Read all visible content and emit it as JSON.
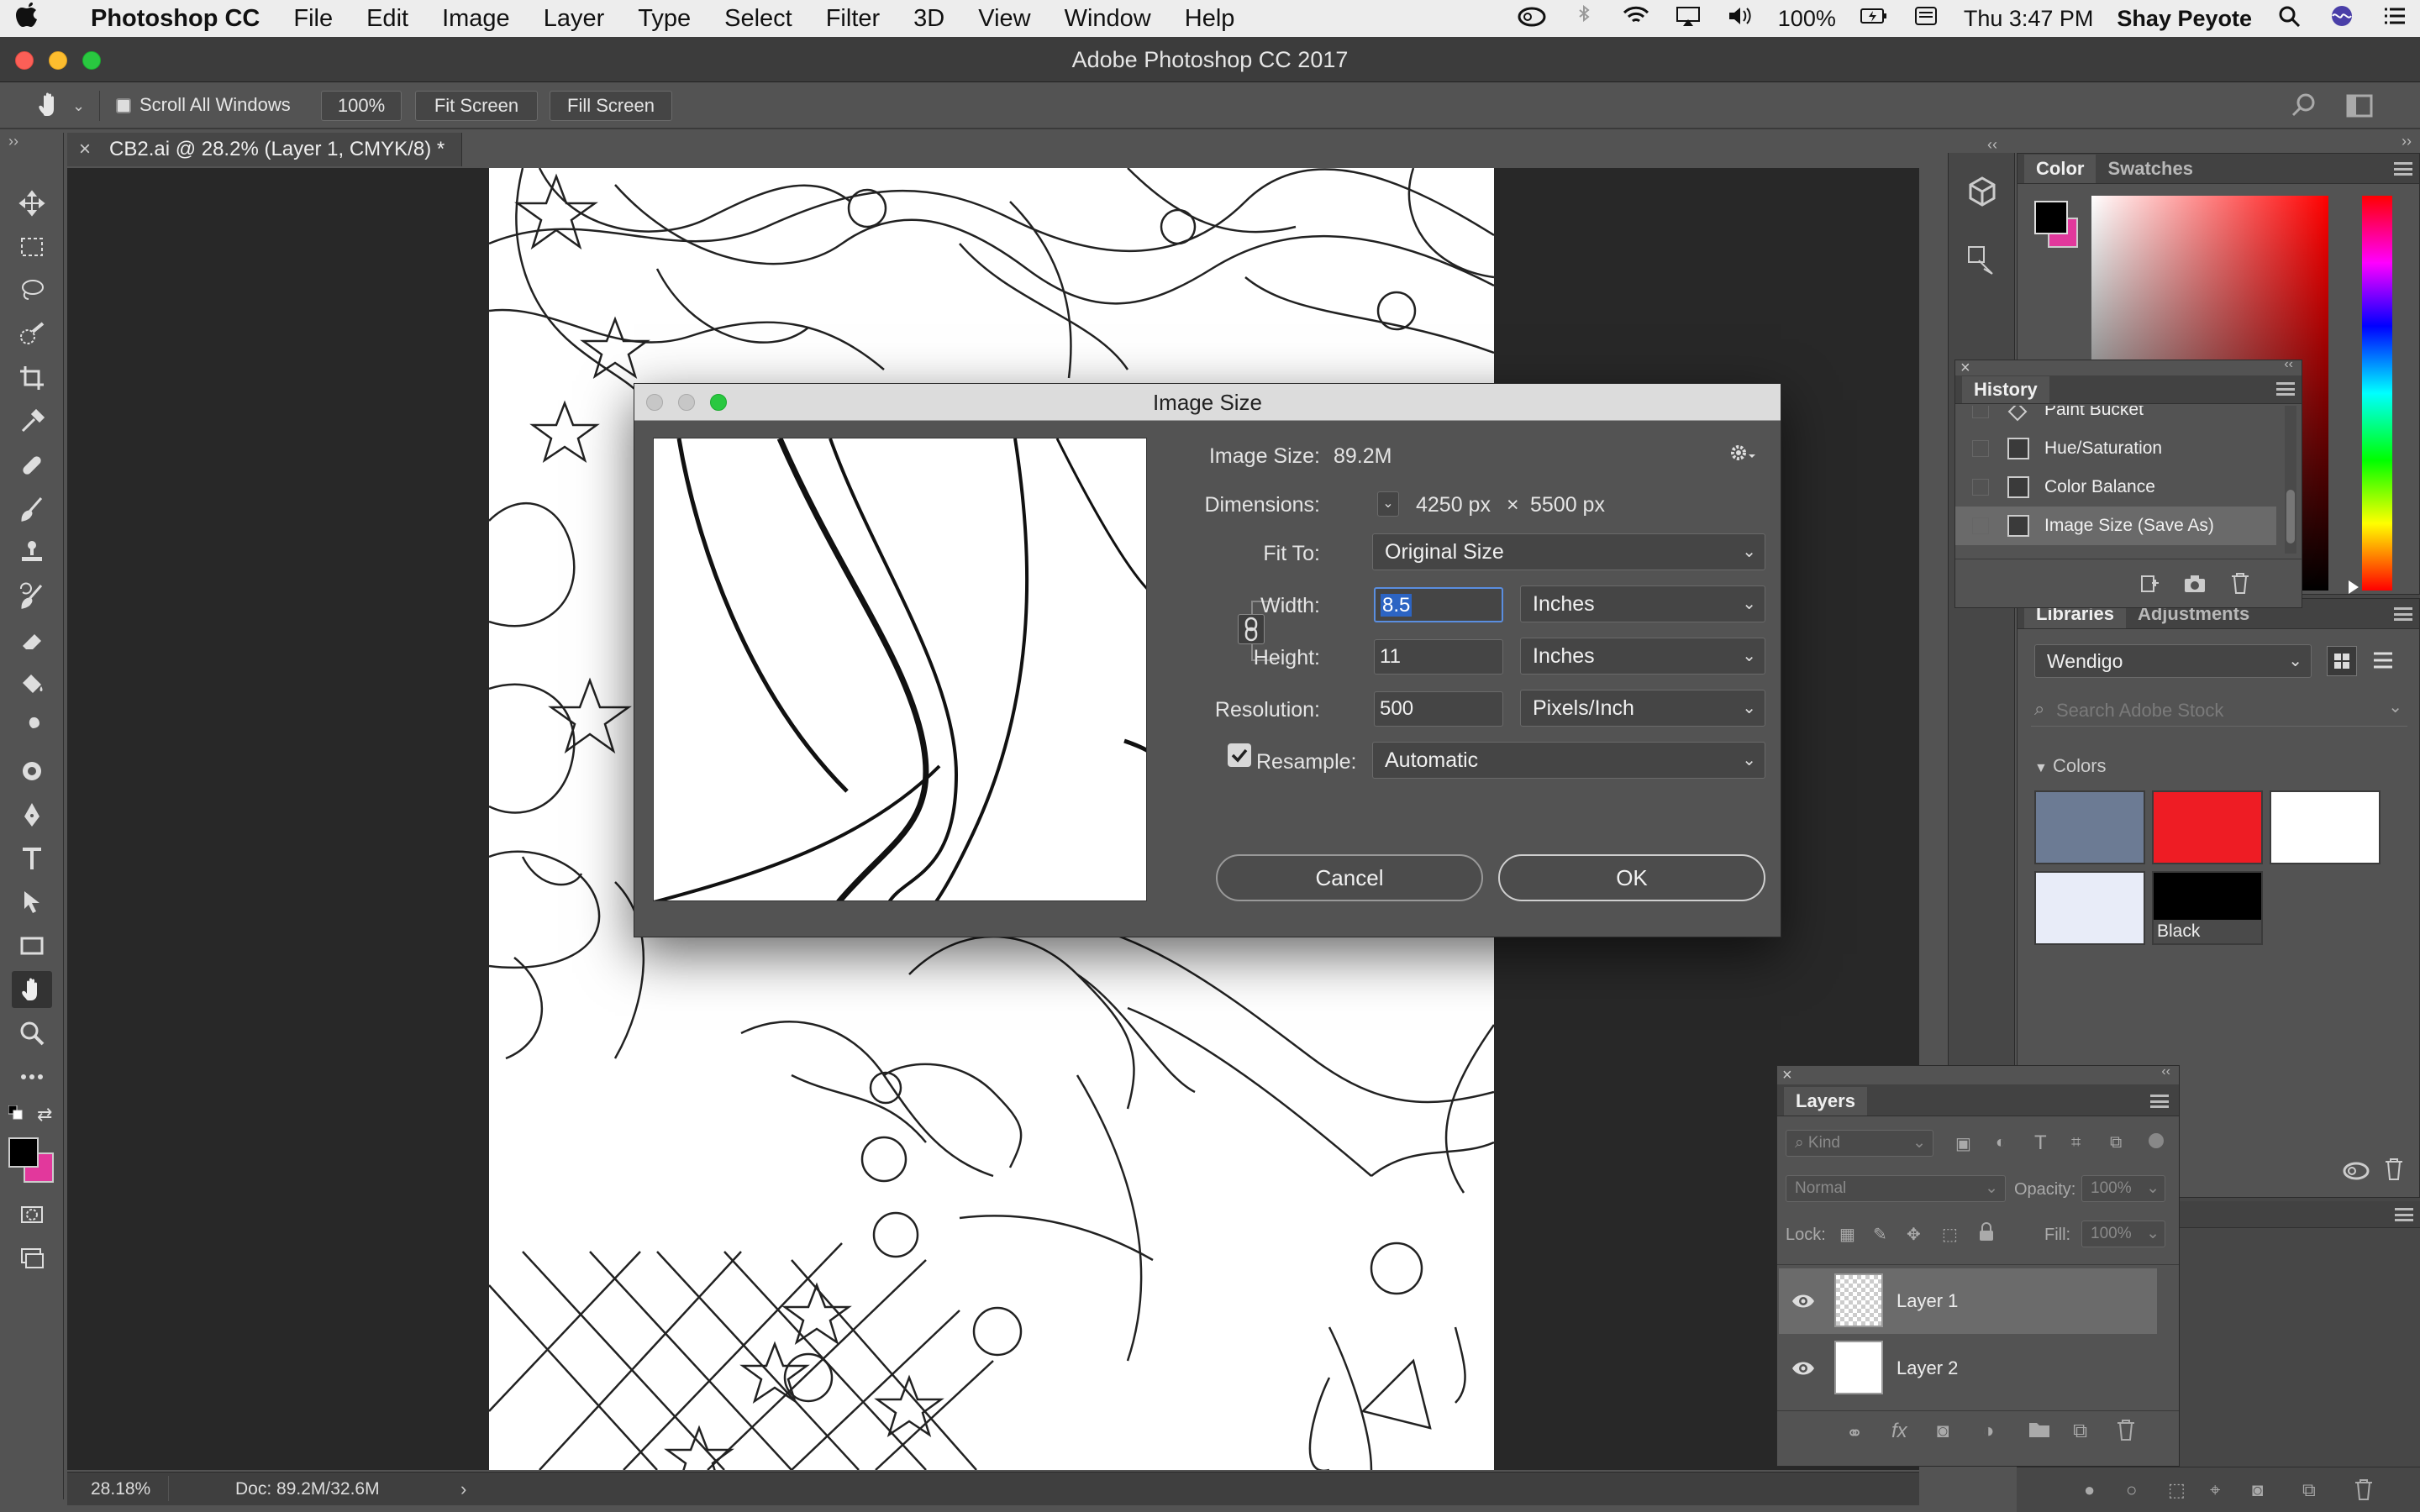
{
  "menubar": {
    "apple": "",
    "app_name": "Photoshop CC",
    "items": [
      "File",
      "Edit",
      "Image",
      "Layer",
      "Type",
      "Select",
      "Filter",
      "3D",
      "View",
      "Window",
      "Help"
    ],
    "battery": "100%",
    "clock": "Thu 3:47 PM",
    "user": "Shay Peyote"
  },
  "window": {
    "title": "Adobe Photoshop CC 2017"
  },
  "options_bar": {
    "scroll_all_windows": "Scroll All Windows",
    "zoom_button": "100%",
    "fit_screen": "Fit Screen",
    "fill_screen": "Fill Screen"
  },
  "document": {
    "tab_title": "CB2.ai @ 28.2% (Layer 1, CMYK/8) *",
    "zoom": "28.18%",
    "doc_info": "Doc: 89.2M/32.6M"
  },
  "color_panel": {
    "tabs": [
      "Color",
      "Swatches"
    ],
    "foreground": "#000000",
    "background": "#e2389c"
  },
  "history_panel": {
    "title": "History",
    "items": [
      "Paint Bucket",
      "Hue/Saturation",
      "Color Balance",
      "Image Size (Save As)"
    ]
  },
  "libraries_panel": {
    "tabs": [
      "Libraries",
      "Adjustments"
    ],
    "library": "Wendigo",
    "search_placeholder": "Search Adobe Stock",
    "colors_header": "Colors",
    "swatches": [
      {
        "color": "#6c7b94",
        "label": ""
      },
      {
        "color": "#ee1c24",
        "label": ""
      },
      {
        "color": "#ffffff",
        "label": ""
      },
      {
        "color": "#e8ecf8",
        "label": ""
      },
      {
        "color": "#000000",
        "label": "Black"
      }
    ]
  },
  "layers_panel": {
    "title": "Layers",
    "filter_kind": "Kind",
    "blend_mode": "Normal",
    "opacity_label": "Opacity:",
    "opacity_value": "100%",
    "lock_label": "Lock:",
    "fill_label": "Fill:",
    "fill_value": "100%",
    "layers": [
      "Layer 1",
      "Layer 2"
    ]
  },
  "image_size_dialog": {
    "title": "Image Size",
    "image_size_label": "Image Size:",
    "image_size_value": "89.2M",
    "dimensions_label": "Dimensions:",
    "dimensions_w": "4250 px",
    "dimensions_x": "×",
    "dimensions_h": "5500 px",
    "fit_to_label": "Fit To:",
    "fit_to_value": "Original Size",
    "width_label": "Width:",
    "width_value": "8.5",
    "width_unit": "Inches",
    "height_label": "Height:",
    "height_value": "11",
    "height_unit": "Inches",
    "resolution_label": "Resolution:",
    "resolution_value": "500",
    "resolution_unit": "Pixels/Inch",
    "resample_label": "Resample:",
    "resample_value": "Automatic",
    "cancel": "Cancel",
    "ok": "OK"
  }
}
